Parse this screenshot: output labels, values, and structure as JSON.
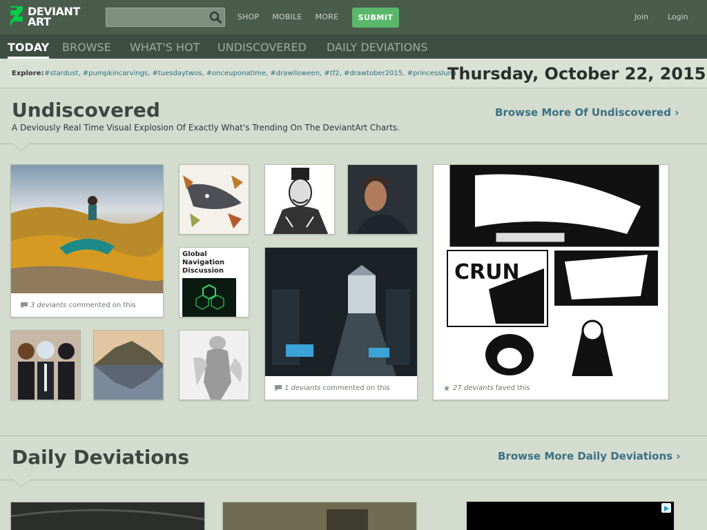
{
  "header": {
    "logo": {
      "line1": "DEVIANT",
      "line2": "ART"
    },
    "search": {
      "placeholder": ""
    },
    "nav": [
      "SHOP",
      "MOBILE",
      "MORE"
    ],
    "submit_label": "SUBMIT",
    "join_label": "Join",
    "login_label": "Login"
  },
  "section_nav": {
    "items": [
      {
        "label": "TODAY",
        "active": true
      },
      {
        "label": "BROWSE",
        "active": false
      },
      {
        "label": "WHAT'S HOT",
        "active": false
      },
      {
        "label": "UNDISCOVERED",
        "active": false
      },
      {
        "label": "DAILY DEVIATIONS",
        "active": false
      }
    ]
  },
  "explore": {
    "label": "Explore:",
    "tags": [
      "#stardust",
      "#pumpkincarvings",
      "#tuesdaytwos",
      "#onceuponatime",
      "#drawlloween",
      "#tf2",
      "#drawtober2015",
      "#princessluna"
    ],
    "date": "Thursday, October 22, 2015"
  },
  "undiscovered": {
    "title": "Undiscovered",
    "subtitle": "A Deviously Real Time Visual Explosion Of Exactly What's Trending On The DeviantArt Charts.",
    "browse_more": "Browse More Of Undiscovered",
    "thumbs": [
      {
        "count": "3 deviants",
        "text": "commented on this"
      },
      {
        "title_line1": "Global",
        "title_line2": "Navigation",
        "title_line3": "Discussion"
      },
      {
        "count": "1 deviants",
        "text": "commented on this"
      },
      {
        "count": "27 deviants",
        "text": "faved this"
      }
    ]
  },
  "daily": {
    "title": "Daily Deviations",
    "browse_more": "Browse More Daily Deviations"
  },
  "colors": {
    "accent_green": "#5bb86b",
    "header_bg": "#4a5c4c",
    "link_teal": "#2e7180"
  }
}
